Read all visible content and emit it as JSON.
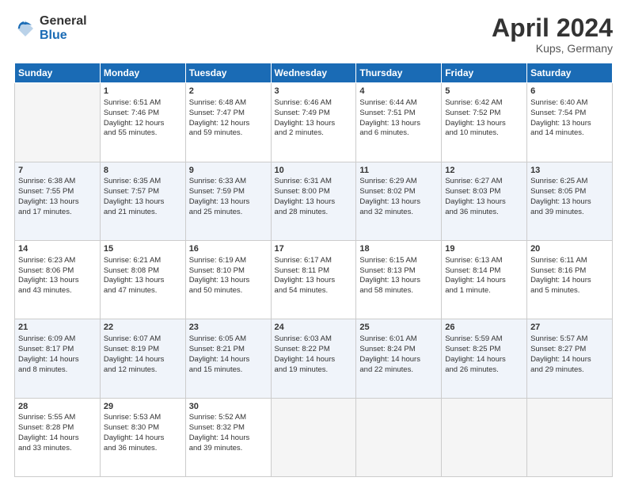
{
  "header": {
    "logo_general": "General",
    "logo_blue": "Blue",
    "month": "April 2024",
    "location": "Kups, Germany"
  },
  "days_of_week": [
    "Sunday",
    "Monday",
    "Tuesday",
    "Wednesday",
    "Thursday",
    "Friday",
    "Saturday"
  ],
  "weeks": [
    [
      {
        "day": "",
        "lines": []
      },
      {
        "day": "1",
        "lines": [
          "Sunrise: 6:51 AM",
          "Sunset: 7:46 PM",
          "Daylight: 12 hours",
          "and 55 minutes."
        ]
      },
      {
        "day": "2",
        "lines": [
          "Sunrise: 6:48 AM",
          "Sunset: 7:47 PM",
          "Daylight: 12 hours",
          "and 59 minutes."
        ]
      },
      {
        "day": "3",
        "lines": [
          "Sunrise: 6:46 AM",
          "Sunset: 7:49 PM",
          "Daylight: 13 hours",
          "and 2 minutes."
        ]
      },
      {
        "day": "4",
        "lines": [
          "Sunrise: 6:44 AM",
          "Sunset: 7:51 PM",
          "Daylight: 13 hours",
          "and 6 minutes."
        ]
      },
      {
        "day": "5",
        "lines": [
          "Sunrise: 6:42 AM",
          "Sunset: 7:52 PM",
          "Daylight: 13 hours",
          "and 10 minutes."
        ]
      },
      {
        "day": "6",
        "lines": [
          "Sunrise: 6:40 AM",
          "Sunset: 7:54 PM",
          "Daylight: 13 hours",
          "and 14 minutes."
        ]
      }
    ],
    [
      {
        "day": "7",
        "lines": [
          "Sunrise: 6:38 AM",
          "Sunset: 7:55 PM",
          "Daylight: 13 hours",
          "and 17 minutes."
        ]
      },
      {
        "day": "8",
        "lines": [
          "Sunrise: 6:35 AM",
          "Sunset: 7:57 PM",
          "Daylight: 13 hours",
          "and 21 minutes."
        ]
      },
      {
        "day": "9",
        "lines": [
          "Sunrise: 6:33 AM",
          "Sunset: 7:59 PM",
          "Daylight: 13 hours",
          "and 25 minutes."
        ]
      },
      {
        "day": "10",
        "lines": [
          "Sunrise: 6:31 AM",
          "Sunset: 8:00 PM",
          "Daylight: 13 hours",
          "and 28 minutes."
        ]
      },
      {
        "day": "11",
        "lines": [
          "Sunrise: 6:29 AM",
          "Sunset: 8:02 PM",
          "Daylight: 13 hours",
          "and 32 minutes."
        ]
      },
      {
        "day": "12",
        "lines": [
          "Sunrise: 6:27 AM",
          "Sunset: 8:03 PM",
          "Daylight: 13 hours",
          "and 36 minutes."
        ]
      },
      {
        "day": "13",
        "lines": [
          "Sunrise: 6:25 AM",
          "Sunset: 8:05 PM",
          "Daylight: 13 hours",
          "and 39 minutes."
        ]
      }
    ],
    [
      {
        "day": "14",
        "lines": [
          "Sunrise: 6:23 AM",
          "Sunset: 8:06 PM",
          "Daylight: 13 hours",
          "and 43 minutes."
        ]
      },
      {
        "day": "15",
        "lines": [
          "Sunrise: 6:21 AM",
          "Sunset: 8:08 PM",
          "Daylight: 13 hours",
          "and 47 minutes."
        ]
      },
      {
        "day": "16",
        "lines": [
          "Sunrise: 6:19 AM",
          "Sunset: 8:10 PM",
          "Daylight: 13 hours",
          "and 50 minutes."
        ]
      },
      {
        "day": "17",
        "lines": [
          "Sunrise: 6:17 AM",
          "Sunset: 8:11 PM",
          "Daylight: 13 hours",
          "and 54 minutes."
        ]
      },
      {
        "day": "18",
        "lines": [
          "Sunrise: 6:15 AM",
          "Sunset: 8:13 PM",
          "Daylight: 13 hours",
          "and 58 minutes."
        ]
      },
      {
        "day": "19",
        "lines": [
          "Sunrise: 6:13 AM",
          "Sunset: 8:14 PM",
          "Daylight: 14 hours",
          "and 1 minute."
        ]
      },
      {
        "day": "20",
        "lines": [
          "Sunrise: 6:11 AM",
          "Sunset: 8:16 PM",
          "Daylight: 14 hours",
          "and 5 minutes."
        ]
      }
    ],
    [
      {
        "day": "21",
        "lines": [
          "Sunrise: 6:09 AM",
          "Sunset: 8:17 PM",
          "Daylight: 14 hours",
          "and 8 minutes."
        ]
      },
      {
        "day": "22",
        "lines": [
          "Sunrise: 6:07 AM",
          "Sunset: 8:19 PM",
          "Daylight: 14 hours",
          "and 12 minutes."
        ]
      },
      {
        "day": "23",
        "lines": [
          "Sunrise: 6:05 AM",
          "Sunset: 8:21 PM",
          "Daylight: 14 hours",
          "and 15 minutes."
        ]
      },
      {
        "day": "24",
        "lines": [
          "Sunrise: 6:03 AM",
          "Sunset: 8:22 PM",
          "Daylight: 14 hours",
          "and 19 minutes."
        ]
      },
      {
        "day": "25",
        "lines": [
          "Sunrise: 6:01 AM",
          "Sunset: 8:24 PM",
          "Daylight: 14 hours",
          "and 22 minutes."
        ]
      },
      {
        "day": "26",
        "lines": [
          "Sunrise: 5:59 AM",
          "Sunset: 8:25 PM",
          "Daylight: 14 hours",
          "and 26 minutes."
        ]
      },
      {
        "day": "27",
        "lines": [
          "Sunrise: 5:57 AM",
          "Sunset: 8:27 PM",
          "Daylight: 14 hours",
          "and 29 minutes."
        ]
      }
    ],
    [
      {
        "day": "28",
        "lines": [
          "Sunrise: 5:55 AM",
          "Sunset: 8:28 PM",
          "Daylight: 14 hours",
          "and 33 minutes."
        ]
      },
      {
        "day": "29",
        "lines": [
          "Sunrise: 5:53 AM",
          "Sunset: 8:30 PM",
          "Daylight: 14 hours",
          "and 36 minutes."
        ]
      },
      {
        "day": "30",
        "lines": [
          "Sunrise: 5:52 AM",
          "Sunset: 8:32 PM",
          "Daylight: 14 hours",
          "and 39 minutes."
        ]
      },
      {
        "day": "",
        "lines": []
      },
      {
        "day": "",
        "lines": []
      },
      {
        "day": "",
        "lines": []
      },
      {
        "day": "",
        "lines": []
      }
    ]
  ]
}
